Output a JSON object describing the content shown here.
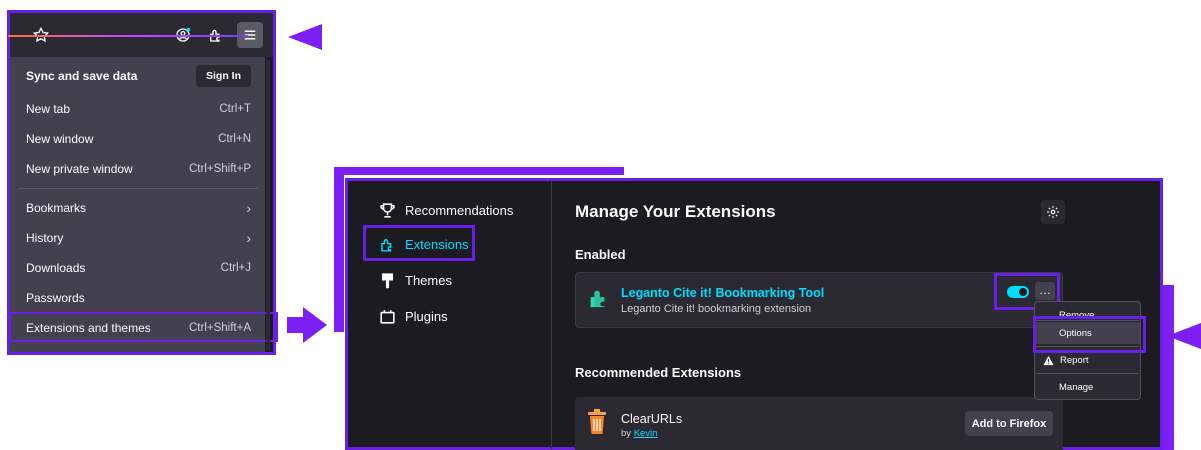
{
  "firefox_menu": {
    "sync_label": "Sync and save data",
    "signin_label": "Sign In",
    "items": [
      {
        "label": "New tab",
        "shortcut": "Ctrl+T"
      },
      {
        "label": "New window",
        "shortcut": "Ctrl+N"
      },
      {
        "label": "New private window",
        "shortcut": "Ctrl+Shift+P"
      },
      {
        "label": "Bookmarks",
        "shortcut": ""
      },
      {
        "label": "History",
        "shortcut": ""
      },
      {
        "label": "Downloads",
        "shortcut": "Ctrl+J"
      },
      {
        "label": "Passwords",
        "shortcut": ""
      },
      {
        "label": "Extensions and themes",
        "shortcut": "Ctrl+Shift+A"
      }
    ]
  },
  "addons": {
    "categories": [
      {
        "label": "Recommendations",
        "icon": "trophy-icon"
      },
      {
        "label": "Extensions",
        "icon": "puzzle-icon"
      },
      {
        "label": "Themes",
        "icon": "brush-icon"
      },
      {
        "label": "Plugins",
        "icon": "plugin-icon"
      }
    ],
    "title": "Manage Your Extensions",
    "enabled_heading": "Enabled",
    "extension": {
      "name": "Leganto Cite it! Bookmarking Tool",
      "description": "Leganto Cite it! bookmarking extension",
      "enabled": true
    },
    "context_menu": {
      "items": [
        "Remove",
        "Options",
        "Report",
        "Manage"
      ]
    },
    "recommended_heading": "Recommended Extensions",
    "recommended": {
      "name": "ClearURLs",
      "by": "by",
      "author": "Kevin",
      "add_label": "Add to Firefox"
    }
  },
  "colors": {
    "highlight": "#6a1fe4",
    "arrow": "#7b1ff3",
    "accent_cyan": "#00ddff",
    "panel_bg": "#1c1b22",
    "menu_bg": "#42414d"
  }
}
